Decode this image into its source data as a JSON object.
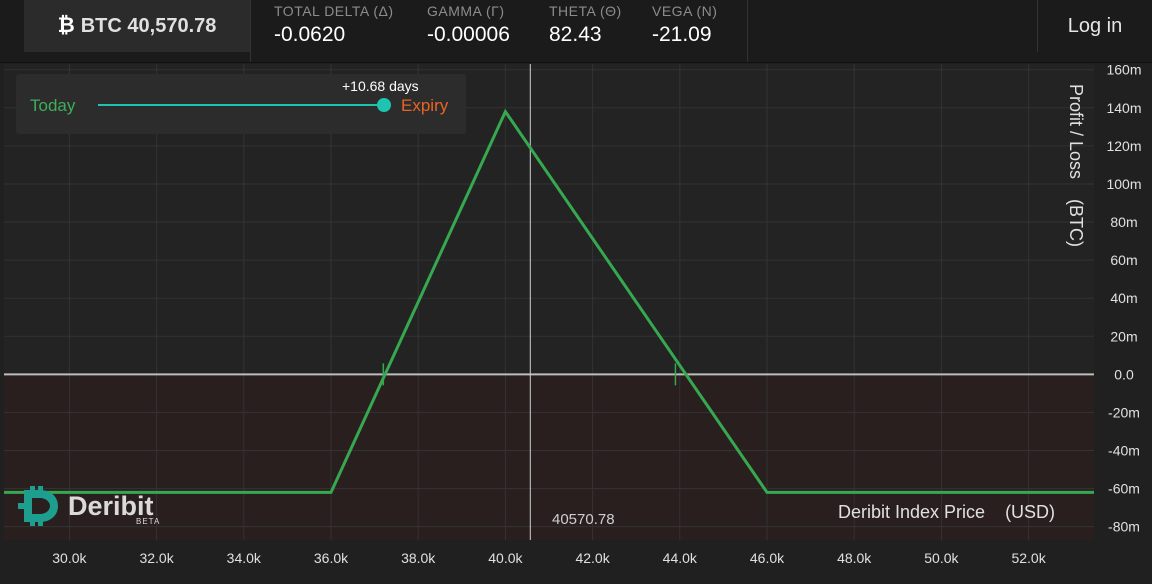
{
  "header": {
    "btc_symbol": "₿",
    "btc_price": "BTC 40,570.78",
    "greeks": [
      {
        "label": "TOTAL DELTA (Δ)",
        "value": "-0.0620"
      },
      {
        "label": "GAMMA (Γ)",
        "value": "-0.00006"
      },
      {
        "label": "THETA (Θ)",
        "value": "82.43"
      },
      {
        "label": "VEGA (Ν)",
        "value": "-21.09"
      }
    ],
    "login_label": "Log in"
  },
  "slider": {
    "today_label": "Today",
    "expiry_label": "Expiry",
    "days_label": "+10.68 days",
    "position_fraction": 1.0
  },
  "logo": {
    "text": "Deribit",
    "beta": "BETA"
  },
  "chart_data": {
    "type": "line",
    "xlabel": "Deribit Index Price    (USD)",
    "ylabel": "Profit / Loss    (BTC)",
    "xlim": [
      28500,
      53500
    ],
    "ylim": [
      -87,
      163
    ],
    "x_ticks": [
      30000,
      32000,
      34000,
      36000,
      38000,
      40000,
      42000,
      44000,
      46000,
      48000,
      50000,
      52000
    ],
    "x_tick_labels": [
      "30.0k",
      "32.0k",
      "34.0k",
      "36.0k",
      "38.0k",
      "40.0k",
      "42.0k",
      "44.0k",
      "46.0k",
      "48.0k",
      "50.0k",
      "52.0k"
    ],
    "y_ticks": [
      160,
      140,
      120,
      100,
      80,
      60,
      40,
      20,
      0,
      -20,
      -40,
      -60,
      -80
    ],
    "y_tick_labels": [
      "160m",
      "140m",
      "120m",
      "100m",
      "80m",
      "60m",
      "40m",
      "20m",
      "0.0",
      "-20m",
      "-40m",
      "-60m",
      "-80m"
    ],
    "grid": true,
    "current_price": 40570.78,
    "current_price_label": "40570.78",
    "series": [
      {
        "x": [
          28500,
          36000,
          40000,
          46000,
          53500
        ],
        "y": [
          -62,
          -62,
          138,
          -62,
          -62
        ]
      }
    ],
    "breakeven_x": [
      37200,
      43900
    ],
    "colors": {
      "line": "#36a84f",
      "zero_line": "#bdbdbd",
      "crosshair": "#cfcfcf",
      "loss_region": "#2a1f1f",
      "grid": "#333333"
    }
  }
}
